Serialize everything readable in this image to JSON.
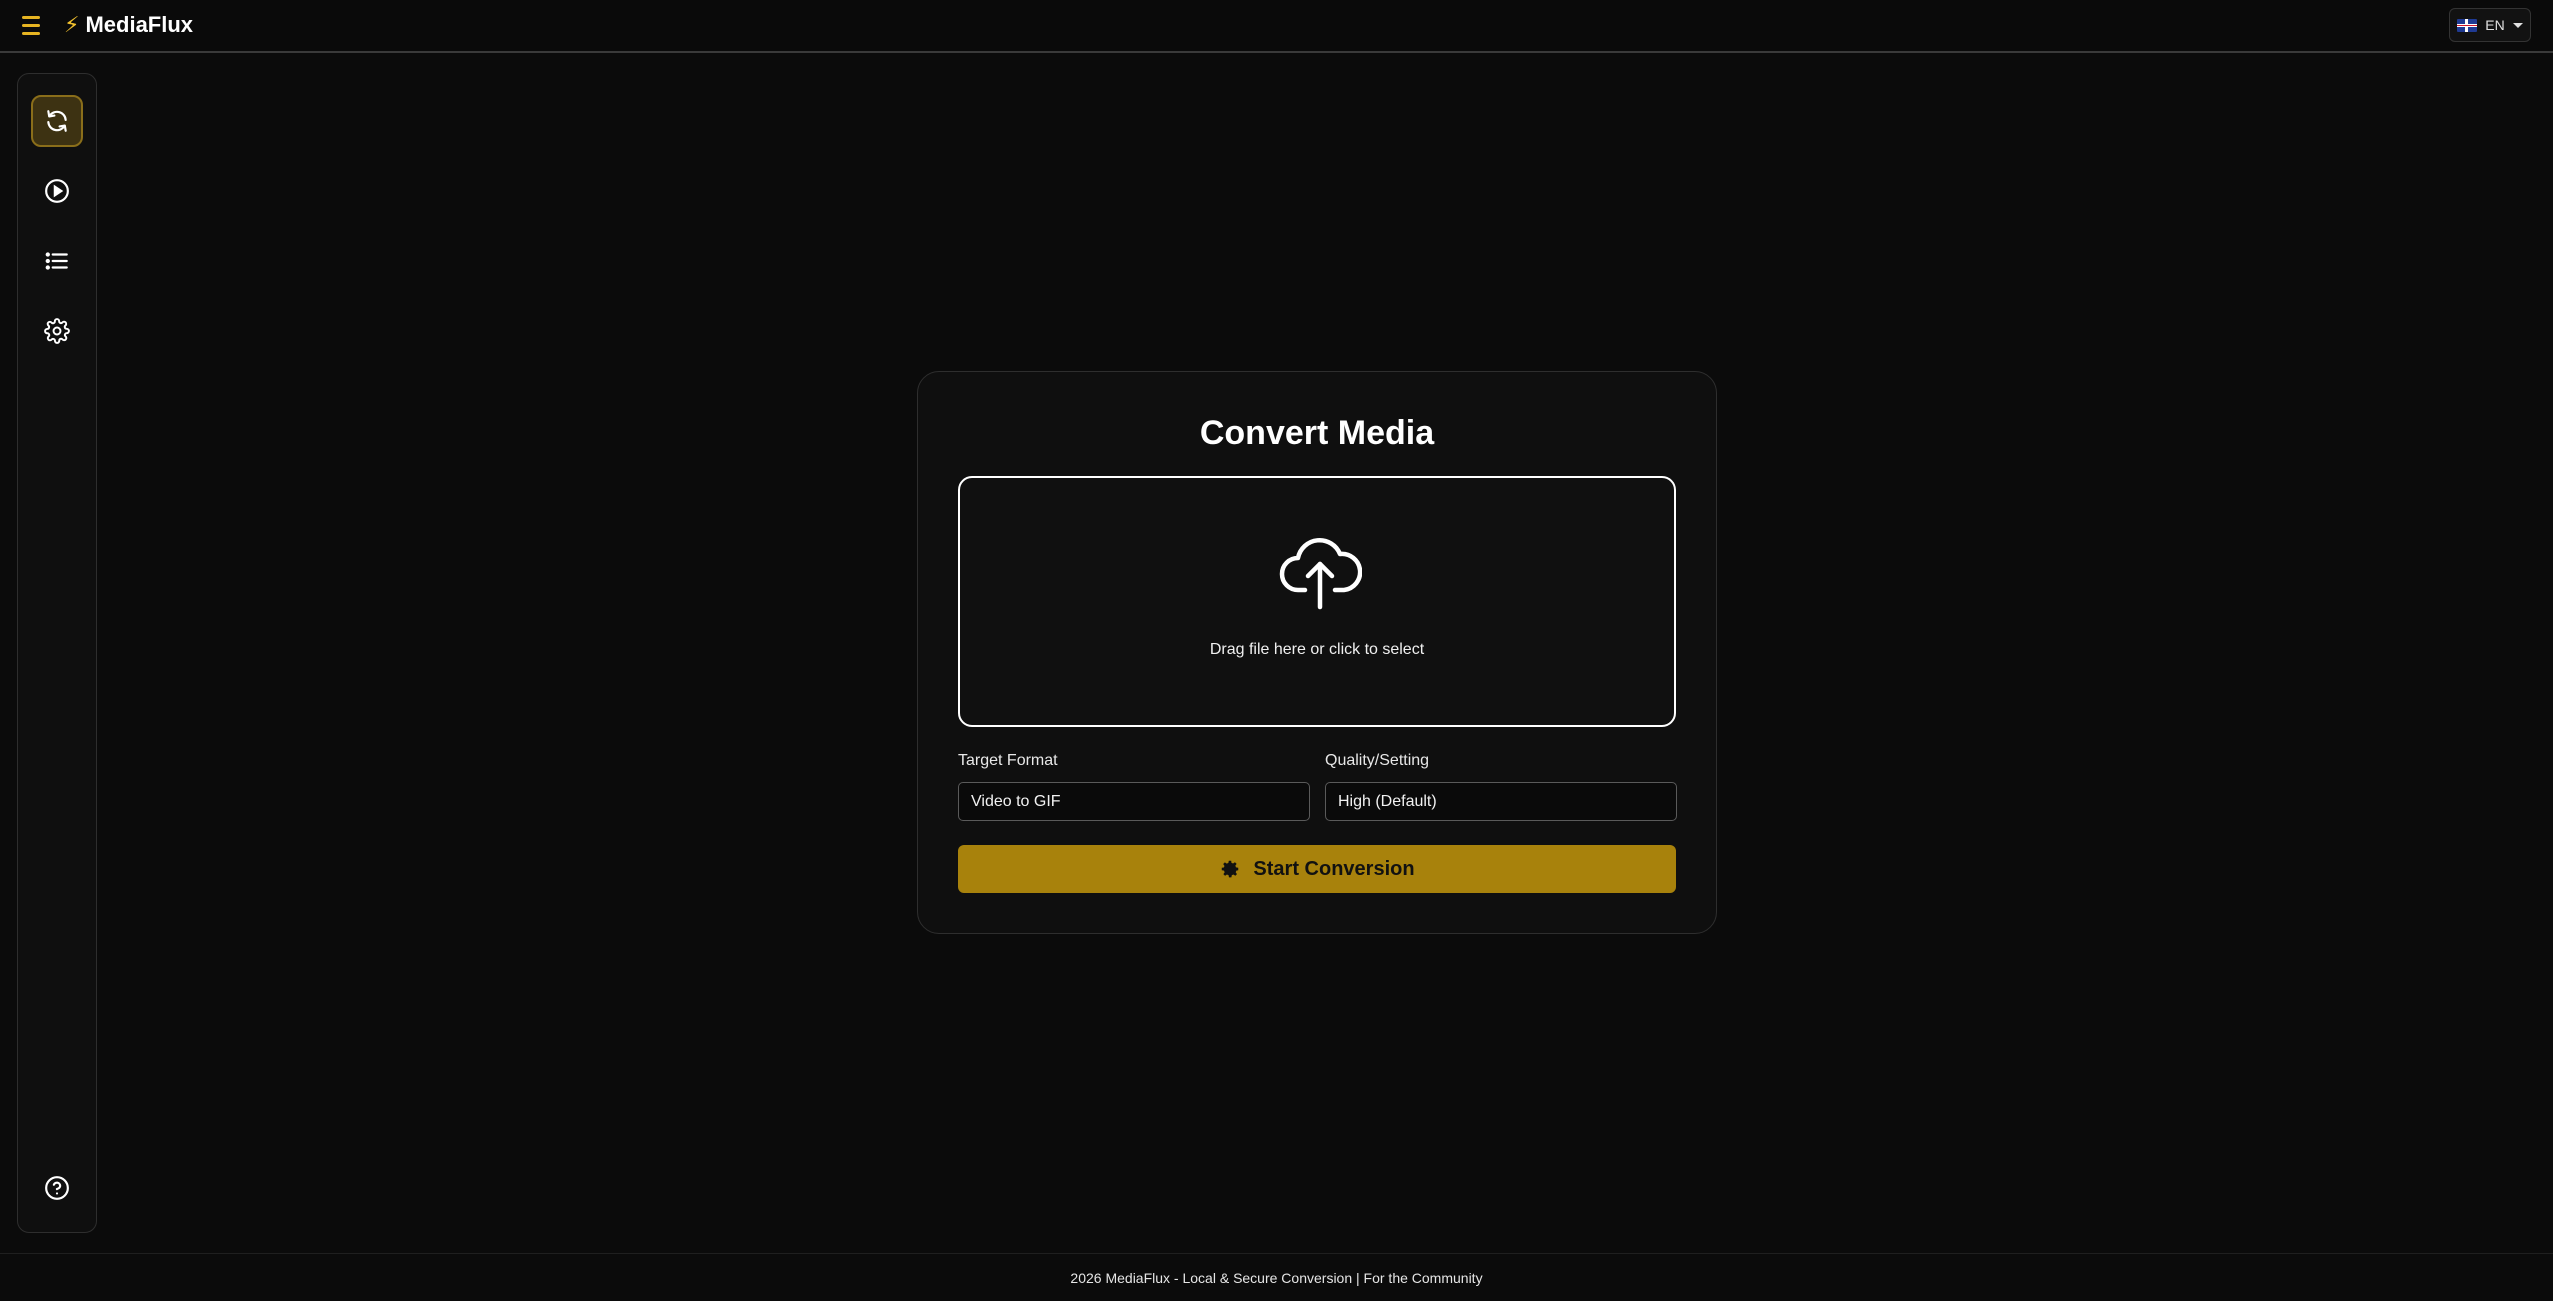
{
  "header": {
    "brand_name": "MediaFlux",
    "brand_icon": "lightning-bolt-icon",
    "language_label": "EN",
    "language_flag": "uk-flag-icon"
  },
  "sidebar": {
    "items": [
      {
        "icon": "convert-icon",
        "active": true
      },
      {
        "icon": "play-icon",
        "active": false
      },
      {
        "icon": "list-icon",
        "active": false
      },
      {
        "icon": "gear-icon",
        "active": false
      }
    ],
    "bottom_icon": "help-icon"
  },
  "main": {
    "title": "Convert Media",
    "dropzone_text": "Drag file here or click to select",
    "target_format_label": "Target Format",
    "target_format_value": "Video to GIF",
    "quality_label": "Quality/Setting",
    "quality_value": "High (Default)",
    "start_button_label": "Start Conversion"
  },
  "footer": {
    "text": "2026 MediaFlux - Local & Secure Conversion | For the Community"
  },
  "colors": {
    "accent": "#e6b422",
    "button": "#a8820c",
    "background": "#0b0b0b"
  }
}
